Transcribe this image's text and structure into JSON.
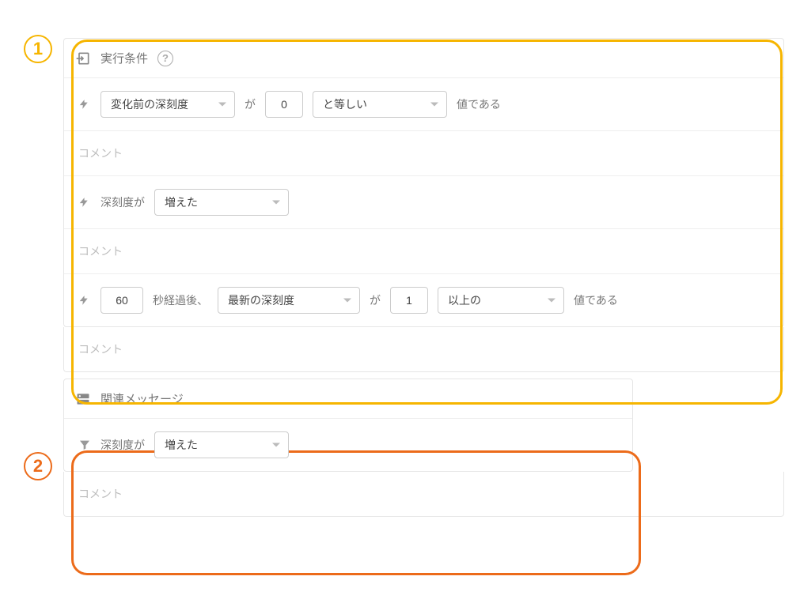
{
  "badges": {
    "one": "1",
    "two": "2"
  },
  "conditions": {
    "title": "実行条件",
    "help": "?",
    "rows": [
      {
        "select1": "変化前の深刻度",
        "ga": "が",
        "value": "0",
        "select2": "と等しい",
        "suffix": "値である"
      },
      {
        "prefix": "深刻度が",
        "select": "増えた"
      },
      {
        "value": "60",
        "after1": "秒経過後、",
        "select1": "最新の深刻度",
        "ga": "が",
        "value2": "1",
        "select2": "以上の",
        "suffix": "値である"
      }
    ],
    "comment_label": "コメント"
  },
  "related": {
    "title": "関連メッセージ",
    "row": {
      "prefix": "深刻度が",
      "select": "増えた"
    },
    "comment_label": "コメント"
  }
}
